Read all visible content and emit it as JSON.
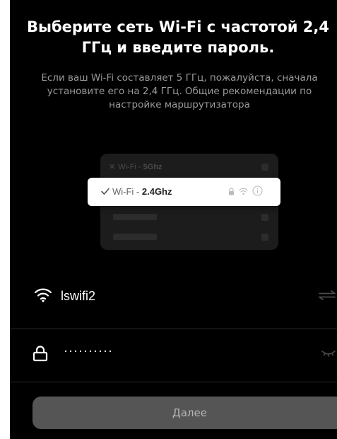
{
  "header": {
    "title": "Выберите сеть Wi-Fi с частотой 2,4 ГГц и введите пароль.",
    "subtitle": "Если ваш Wi-Fi составляет 5 ГГц, пожалуйста, сначала установите его на 2,4 ГГц. Общие рекомендации по настройке маршрутизатора"
  },
  "illustration": {
    "row_5ghz_prefix": "Wi-Fi - ",
    "row_5ghz_band": "5Ghz",
    "row_24ghz_prefix": "Wi-Fi - ",
    "row_24ghz_band": "2.4Ghz"
  },
  "wifi": {
    "ssid": "lswifi2",
    "password_masked": "··········"
  },
  "actions": {
    "next_label": "Далее"
  },
  "icons": [
    "wifi-icon",
    "swap-icon",
    "lock-icon",
    "eye-closed-icon",
    "check-icon",
    "info-icon"
  ],
  "colors": {
    "background": "#000000",
    "button": "#555555",
    "button_text": "#b5b5b5",
    "subtitle": "#9a9a9a"
  }
}
